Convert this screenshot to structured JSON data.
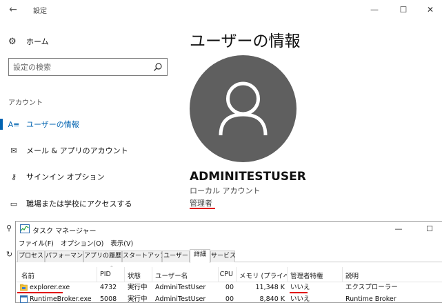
{
  "settings": {
    "app_title": "設定",
    "back_glyph": "←",
    "window_controls": {
      "minimize": "—",
      "maximize": "☐",
      "close": "✕"
    },
    "home_label": "ホーム",
    "search_placeholder": "設定の検索",
    "section_heading": "アカウント",
    "nav_items": [
      {
        "label": "ユーザーの情報",
        "icon": "user-info-icon",
        "glyph": "A≡",
        "active": true
      },
      {
        "label": "メール & アプリのアカウント",
        "icon": "mail-icon",
        "glyph": "✉",
        "active": false
      },
      {
        "label": "サインイン オプション",
        "icon": "key-icon",
        "glyph": "⚷",
        "active": false
      },
      {
        "label": "職場または学校にアクセスする",
        "icon": "briefcase-icon",
        "glyph": "▭",
        "active": false
      }
    ],
    "page_title": "ユーザーの情報",
    "user_name": "ADMINITESTUSER",
    "account_type": "ローカル アカウント",
    "account_role": "管理者",
    "accent_color": "#0063b1",
    "highlight_color": "#e10000"
  },
  "taskmgr": {
    "title": "タスク マネージャー",
    "window_controls": {
      "minimize": "—",
      "maximize": "☐"
    },
    "menu": [
      "ファイル(F)",
      "オプション(O)",
      "表示(V)"
    ],
    "tabs": [
      "プロセス",
      "パフォーマンス",
      "アプリの履歴",
      "スタートアップ",
      "ユーザー",
      "詳細",
      "サービス"
    ],
    "selected_tab": "詳細",
    "columns": [
      "名前",
      "PID",
      "状態",
      "ユーザー名",
      "CPU",
      "メモリ (プライベ...",
      "管理者特権",
      "説明"
    ],
    "rows": [
      {
        "name": "explorer.exe",
        "pid": "4732",
        "status": "実行中",
        "user": "AdminiTestUser",
        "cpu": "00",
        "memory": "11,348 K",
        "elevated": "いいえ",
        "description": "エクスプローラー"
      },
      {
        "name": "RuntimeBroker.exe",
        "pid": "5008",
        "status": "実行中",
        "user": "AdminiTestUser",
        "cpu": "00",
        "memory": "8,840 K",
        "elevated": "いいえ",
        "description": "Runtime Broker"
      }
    ]
  }
}
